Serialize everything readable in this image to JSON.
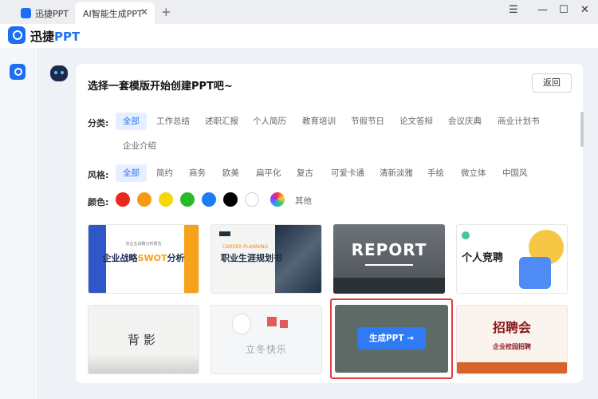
{
  "titlebar": {
    "tabs": [
      {
        "label": "迅捷PPT"
      },
      {
        "label": "AI智能生成PPT"
      }
    ],
    "tab_close": "✕",
    "new_tab": "+",
    "window_controls": {
      "menu": "☰",
      "minimize": "—",
      "maximize": "☐",
      "close": "✕"
    }
  },
  "app": {
    "brand_prefix": "迅捷",
    "brand_suffix": "PPT"
  },
  "main": {
    "headline": "选择一套模版开始创建PPT吧~",
    "back_label": "返回"
  },
  "filters": {
    "category_label": "分类:",
    "categories": [
      "全部",
      "工作总结",
      "述职汇报",
      "个人简历",
      "教育培训",
      "节假节日",
      "论文答辩",
      "会议庆典",
      "商业计划书",
      "企业介绍"
    ],
    "style_label": "风格:",
    "styles": [
      "全部",
      "简约",
      "商务",
      "欧美",
      "扁平化",
      "复古",
      "可爱卡通",
      "清新淡雅",
      "手绘",
      "微立体",
      "中国风"
    ],
    "color_label": "颜色:",
    "colors": [
      "#e8281e",
      "#f59b12",
      "#f5d80a",
      "#2bb82b",
      "#1c7cf4",
      "#000000",
      "#ffffff"
    ],
    "color_other": "其他"
  },
  "templates": [
    {
      "title_a": "企业战略",
      "title_b": "SWOT",
      "title_c": "分析",
      "small": "年企业战略分析报告"
    },
    {
      "title": "职业生涯规划书",
      "sub": "CAREER PLANNING"
    },
    {
      "title": "REPORT"
    },
    {
      "title": "个人竞聘"
    },
    {
      "title": "背影"
    },
    {
      "title": "立冬快乐"
    },
    {
      "button": "生成PPT →"
    },
    {
      "title": "招聘会",
      "sub": "企业校园招聘"
    }
  ]
}
